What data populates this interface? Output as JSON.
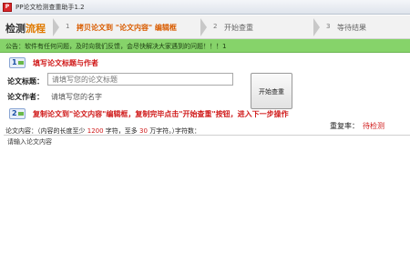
{
  "window": {
    "title": "PP论文检测查重助手1.2",
    "icon_text": "P"
  },
  "steps": {
    "header_main": "检测",
    "header_accent": "流程",
    "items": [
      {
        "num": "1",
        "label": "拷贝论文到 \"论文内容\" 编辑框"
      },
      {
        "num": "2",
        "label": "开始查重"
      },
      {
        "num": "3",
        "label": "等待结果"
      }
    ]
  },
  "notice": {
    "text": "公告：软件有任何问题，及时向我们反馈，会尽快解决大家遇到的问题！！！1"
  },
  "section1": {
    "num": "1",
    "title": "填写论文标题与作者"
  },
  "form": {
    "title_label": "论文标题：",
    "title_placeholder": "请填写您的论文标题",
    "author_label": "论文作者：",
    "author_placeholder": "请填写您的名字"
  },
  "start_button": {
    "label": "开始查重"
  },
  "section2": {
    "num": "2",
    "title": "复制论文到\"论文内容\"编辑框，复制完毕点击\"开始查重\"按钮，进入下一步操作"
  },
  "result": {
    "rate_label": "重复率：",
    "rate_value": "待检测"
  },
  "content": {
    "label_prefix": "论文内容：（内容的长度至少",
    "min_len": "1200",
    "label_mid": "字符，至多",
    "max_len": "30",
    "label_suffix": "万字符。）",
    "char_count_label": "字符数：",
    "placeholder": "请输入论文内容"
  },
  "colors": {
    "notice_bg": "#86d36a",
    "accent_orange": "#e07a00",
    "alert_red": "#d01a1a"
  }
}
